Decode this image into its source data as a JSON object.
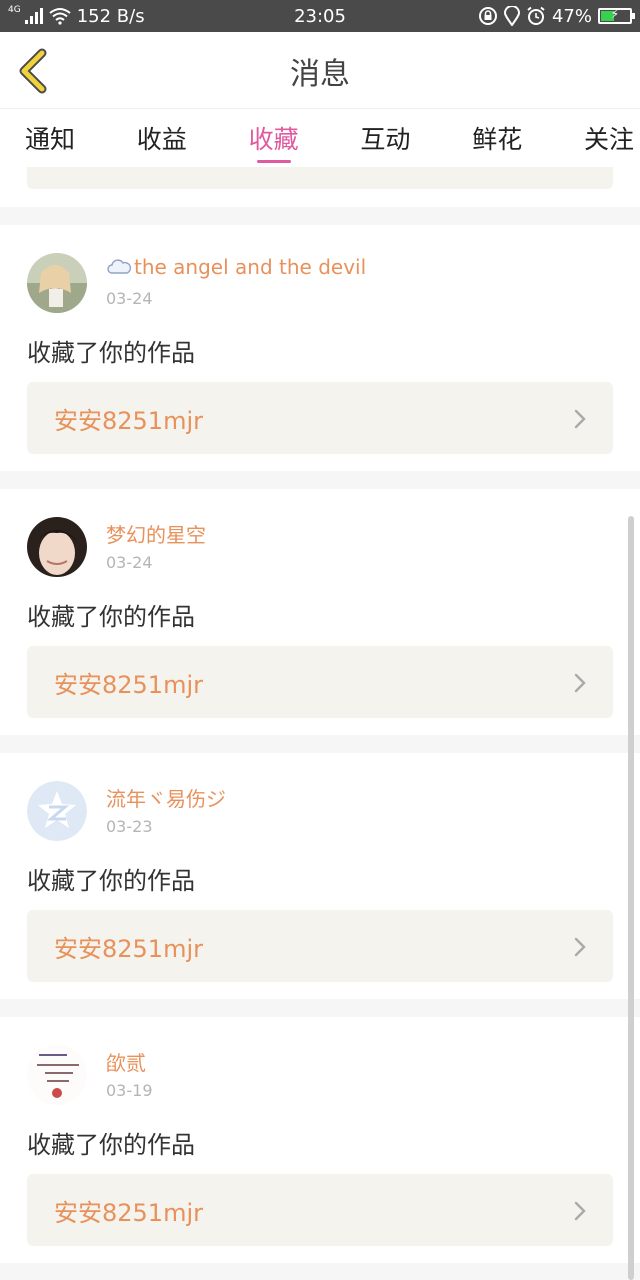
{
  "status_bar": {
    "network": "4G",
    "speed": "152 B/s",
    "time": "23:05",
    "battery": "47%",
    "battery_level": 0.47,
    "icons": [
      "signal-icon",
      "wifi-icon",
      "lock-rotation-icon",
      "location-icon",
      "alarm-icon",
      "battery-charging-icon"
    ]
  },
  "header": {
    "title": "消息",
    "back_icon": "chevron-left-icon",
    "accent_color": "#f1d23b"
  },
  "tabs": [
    {
      "label": "通知",
      "active": false
    },
    {
      "label": "收益",
      "active": false
    },
    {
      "label": "收藏",
      "active": true
    },
    {
      "label": "互动",
      "active": false
    },
    {
      "label": "鲜花",
      "active": false
    },
    {
      "label": "关注",
      "active": false
    }
  ],
  "colors": {
    "active_tab": "#e05a9f",
    "name": "#e8915b",
    "work_bg": "#f5f3ee"
  },
  "messages": [
    {
      "name": "the angel and the devil",
      "name_icon": "cloud-icon",
      "date": "03-24",
      "action": "收藏了你的作品",
      "work": "安安8251mjr"
    },
    {
      "name": "梦幻的星空",
      "date": "03-24",
      "action": "收藏了你的作品",
      "work": "安安8251mjr"
    },
    {
      "name": "流年ヾ易伤ジ",
      "date": "03-23",
      "action": "收藏了你的作品",
      "work": "安安8251mjr"
    },
    {
      "name": "欿贰",
      "date": "03-19",
      "action": "收藏了你的作品",
      "work": "安安8251mjr"
    }
  ]
}
